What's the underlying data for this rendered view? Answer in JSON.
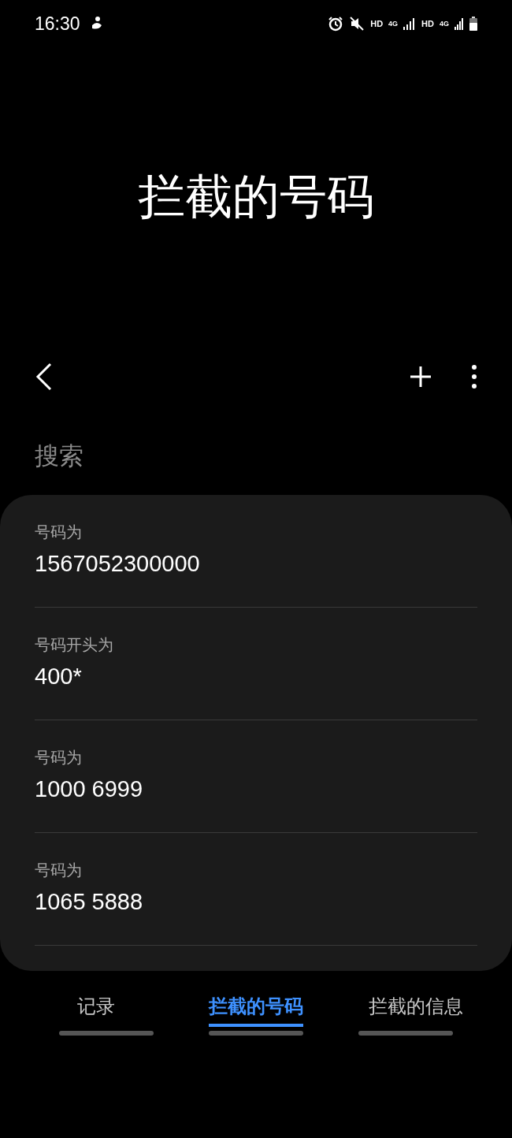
{
  "status_bar": {
    "time": "16:30",
    "indicators": [
      "HD",
      "4G",
      "HD",
      "4G"
    ]
  },
  "title": "拦截的号码",
  "search": {
    "placeholder": "搜索"
  },
  "blocked": [
    {
      "rule": "号码为",
      "number": "1567052300000"
    },
    {
      "rule": "号码开头为",
      "number": "400*"
    },
    {
      "rule": "号码为",
      "number": "1000 6999"
    },
    {
      "rule": "号码为",
      "number": "1065 5888"
    }
  ],
  "tabs": [
    {
      "label": "记录",
      "selected": false
    },
    {
      "label": "拦截的号码",
      "selected": true
    },
    {
      "label": "拦截的信息",
      "selected": false
    }
  ]
}
